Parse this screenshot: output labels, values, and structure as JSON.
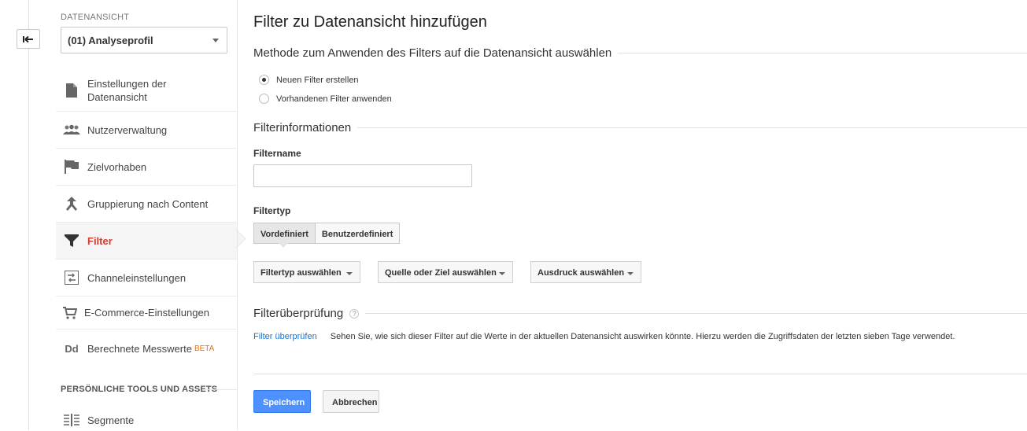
{
  "sidebar": {
    "view_label": "DATENANSICHT",
    "view_selected": "(01) Analyseprofil",
    "items": [
      {
        "icon": "document-icon",
        "label": "Einstellungen der Datenansicht"
      },
      {
        "icon": "people-icon",
        "label": "Nutzerverwaltung"
      },
      {
        "icon": "flag-icon",
        "label": "Zielvorhaben"
      },
      {
        "icon": "merge-icon",
        "label": "Gruppierung nach Content"
      },
      {
        "icon": "filter-icon",
        "label": "Filter",
        "active": true
      },
      {
        "icon": "channel-icon",
        "label": "Channeleinstellungen"
      },
      {
        "icon": "cart-icon",
        "label": "E-Commerce-Einstellungen"
      },
      {
        "icon": "dd-icon",
        "label": "Berechnete Messwerte",
        "badge": "BETA"
      }
    ],
    "tools_header": "PERSÖNLICHE TOOLS UND ASSETS",
    "tools_items": [
      {
        "icon": "segments-icon",
        "label": "Segmente"
      }
    ]
  },
  "main": {
    "title": "Filter zu Datenansicht hinzufügen",
    "method_section": "Methode zum Anwenden des Filters auf die Datenansicht auswählen",
    "radio_new": "Neuen Filter erstellen",
    "radio_existing": "Vorhandenen Filter anwenden",
    "info_section": "Filterinformationen",
    "filtername_label": "Filtername",
    "filtername_value": "",
    "filtertyp_label": "Filtertyp",
    "seg_predefined": "Vordefiniert",
    "seg_custom": "Benutzerdefiniert",
    "dd_filtertyp": "Filtertyp auswählen",
    "dd_quelle": "Quelle oder Ziel auswählen",
    "dd_ausdruck": "Ausdruck auswählen",
    "verify_section": "Filterüberprüfung",
    "verify_help": "?",
    "verify_link": "Filter überprüfen",
    "verify_text": "Sehen Sie, wie sich dieser Filter auf die Werte in der aktuellen Datenansicht auswirken könnte. Hierzu werden die Zugriffsdaten der letzten sieben Tage verwendet.",
    "save": "Speichern",
    "cancel": "Abbrechen"
  },
  "colors": {
    "accent_red": "#d23f31",
    "primary_blue": "#4d90fe",
    "link_blue": "#1a73c8"
  }
}
